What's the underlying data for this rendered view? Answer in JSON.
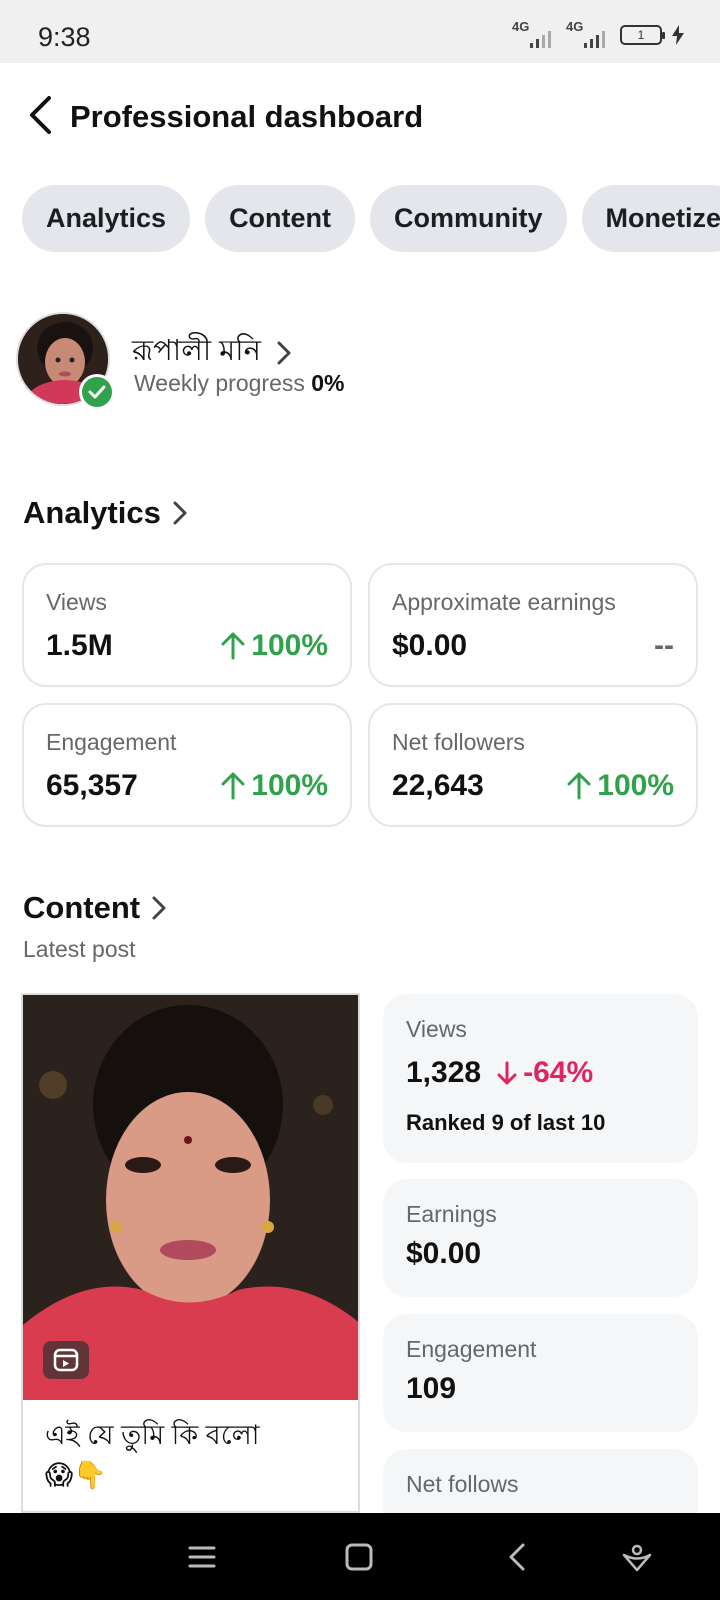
{
  "status_bar": {
    "time": "9:38",
    "network_1": "4G",
    "network_2": "4G",
    "battery": "1"
  },
  "header": {
    "title": "Professional dashboard"
  },
  "tabs": [
    {
      "label": "Analytics"
    },
    {
      "label": "Content"
    },
    {
      "label": "Community"
    },
    {
      "label": "Monetize"
    }
  ],
  "profile": {
    "name": "রূপালী মনি",
    "progress_label": "Weekly progress",
    "progress_value": "0%"
  },
  "analytics": {
    "title": "Analytics",
    "cards": [
      {
        "label": "Views",
        "value": "1.5M",
        "change": "100%",
        "trend": "up"
      },
      {
        "label": "Approximate earnings",
        "value": "$0.00",
        "change": "--",
        "trend": "none"
      },
      {
        "label": "Engagement",
        "value": "65,357",
        "change": "100%",
        "trend": "up"
      },
      {
        "label": "Net followers",
        "value": "22,643",
        "change": "100%",
        "trend": "up"
      }
    ]
  },
  "content": {
    "title": "Content",
    "subtitle": "Latest post",
    "post": {
      "caption": "এই যে তুমি কি বলো",
      "emoji": "😱👇"
    },
    "stats": {
      "views": {
        "label": "Views",
        "value": "1,328",
        "change": "-64%",
        "rank": "Ranked 9 of last 10"
      },
      "earnings": {
        "label": "Earnings",
        "value": "$0.00"
      },
      "engagement": {
        "label": "Engagement",
        "value": "109"
      },
      "net_follows": {
        "label": "Net follows"
      }
    }
  },
  "colors": {
    "positive": "#31a24c",
    "negative": "#e0245e",
    "chip_bg": "#e4e6eb"
  },
  "icons": [
    "back-arrow-icon",
    "chevron-right-icon",
    "verified-check-icon",
    "arrow-up-icon",
    "arrow-down-icon",
    "reel-icon",
    "menu-icon",
    "home-square-icon",
    "nav-back-icon",
    "assistant-icon"
  ]
}
